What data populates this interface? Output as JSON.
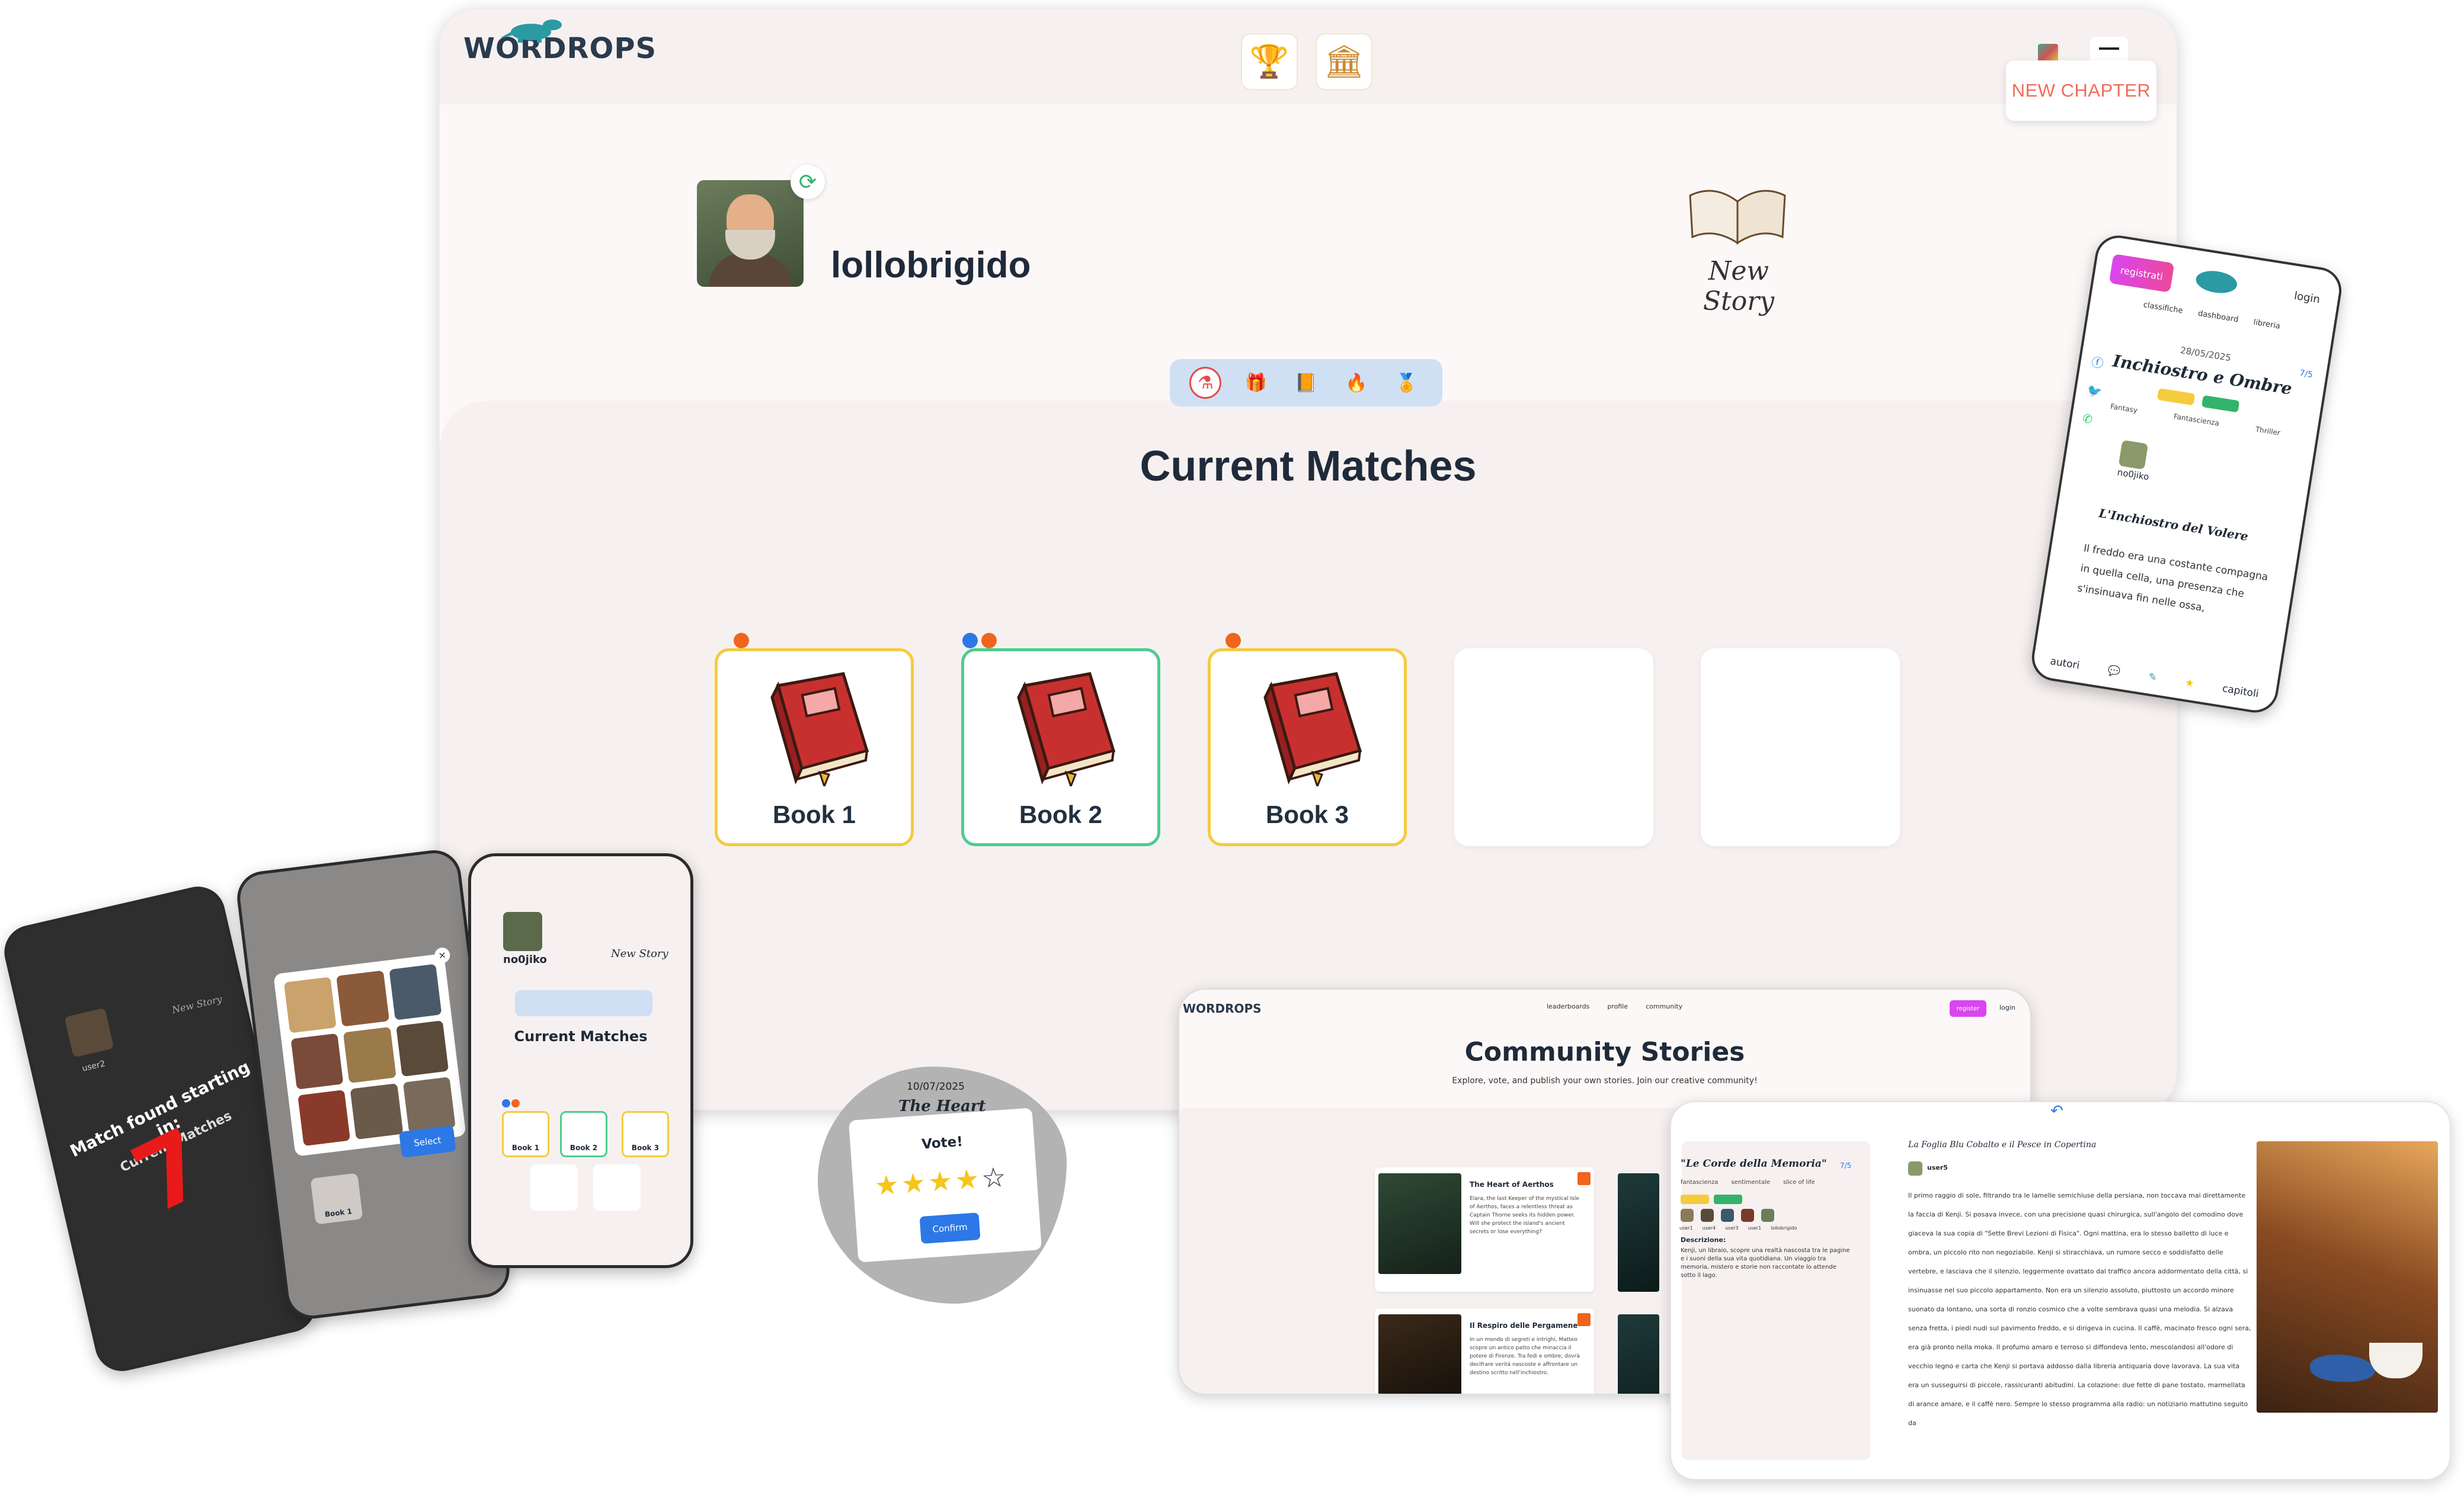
{
  "main": {
    "logo": "WORDROPS",
    "header_icons": [
      "trophy-icon",
      "library-icon"
    ],
    "new_chapter": "NEW CHAPTER",
    "username": "lollobrigido",
    "new_story": "New Story",
    "categories": [
      "potion-icon",
      "gift-icon",
      "book-icon",
      "flame-icon",
      "medal-icon"
    ],
    "section_title": "Current Matches",
    "cards": [
      {
        "label": "Book 1",
        "border": "#f5cb3e",
        "dots": [
          "#f1641e"
        ]
      },
      {
        "label": "Book 2",
        "border": "#4dcc8f",
        "dots": [
          "#2d78e6",
          "#f1641e"
        ]
      },
      {
        "label": "Book 3",
        "border": "#f5cb3e",
        "dots": [
          "#f1641e"
        ]
      },
      {
        "label": ""
      },
      {
        "label": ""
      }
    ]
  },
  "phone_right": {
    "register": "registrati",
    "login": "login",
    "nav": [
      "classifiche",
      "dashboard",
      "libreria"
    ],
    "date": "28/05/2025",
    "title": "Inchiostro e Ombre",
    "genres": [
      "Fantasy",
      "Fantascienza",
      "Thriller"
    ],
    "count": "7/5",
    "user": "no0jiko",
    "chapter_title": "L'Inchiostro del Volere",
    "text": "Il freddo era una costante compagna in quella cella, una presenza che s'insinuava fin nelle ossa,",
    "bottom": [
      "autori",
      "capitoli"
    ]
  },
  "phone_dark": {
    "match_line1": "Match found starting in:",
    "match_line2": "Current Matches",
    "count": "7",
    "user": "user2",
    "new_story": "New Story"
  },
  "phone_gray": {
    "select": "Select",
    "card": "Book 1"
  },
  "phone_light": {
    "user": "no0jiko",
    "new_story": "New Story",
    "title": "Current Matches",
    "cards": [
      "Book 1",
      "Book 2",
      "Book 3"
    ]
  },
  "vote": {
    "date": "10/07/2025",
    "title": "The Heart",
    "label": "Vote!",
    "stars_filled": 4,
    "stars_total": 5,
    "confirm": "Confirm"
  },
  "community": {
    "logo": "WORDROPS",
    "nav": [
      "leaderboards",
      "profile",
      "community"
    ],
    "register": "register",
    "login": "login",
    "title": "Community Stories",
    "subtitle": "Explore, vote, and publish your own stories. Join our creative community!",
    "cards": [
      {
        "title": "The Heart of Aerthos",
        "desc": "Elara, the last Keeper of the mystical Isle of Aerthos, faces a relentless threat as Captain Thorne seeks its hidden power. Will she protect the island's ancient secrets or lose everything?"
      },
      {
        "title": "Il Respiro delle Pergamene",
        "desc": "In un mondo di segreti e intrighi, Matteo scopre un antico patto che minaccia il potere di Firenze. Tra fedi e ombre, dovrà decifrare verità nascoste e affrontare un destino scritto nell'inchiostro."
      }
    ]
  },
  "reader": {
    "panel_title": "\"Le Corde della Memoria\"",
    "genres": [
      "fantascienza",
      "sentimentale",
      "slice of life"
    ],
    "count": "7/5",
    "authors": [
      "user1",
      "user4",
      "user3",
      "user1",
      "lollobrigido"
    ],
    "desc_label": "Descrizione:",
    "desc": "Kenji, un libraio, scopre una realtà nascosta tra le pagine e i suoni della sua vita quotidiana. Un viaggio tra memoria, mistero e storie non raccontate lo attende sotto il lago.",
    "chapter_title": "La Foglia Blu Cobalto e il Pesce in Copertina",
    "user": "user5",
    "text": "Il primo raggio di sole, filtrando tra le lamelle semichiuse della persiana, non toccava mai direttamente la faccia di Kenji. Si posava invece, con una precisione quasi chirurgica, sull'angolo del comodino dove giaceva la sua copia di \"Sette Brevi Lezioni di Fisica\". Ogni mattina, era lo stesso balletto di luce e ombra, un piccolo rito non negoziabile. Kenji si stiracchiava, un rumore secco e soddisfatto delle vertebre, e lasciava che il silenzio, leggermente ovattato dal traffico ancora addormentato della città, si insinuasse nel suo piccolo appartamento. Non era un silenzio assoluto, piuttosto un accordo minore suonato da lontano, una sorta di ronzio cosmico che a volte sembrava quasi una melodia. Si alzava senza fretta, i piedi nudi sul pavimento freddo, e si dirigeva in cucina. Il caffè, macinato fresco ogni sera, era già pronto nella moka. Il profumo amaro e terroso si diffondeva lento, mescolandosi all'odore di vecchio legno e carta che Kenji si portava addosso dalla libreria antiquaria dove lavorava. La sua vita era un susseguirsi di piccole, rassicuranti abitudini. La colazione: due fette di pane tostato, marmellata di arance amare, e il caffè nero. Sempre lo stesso programma alla radio: un notiziario mattutino seguito da"
  }
}
